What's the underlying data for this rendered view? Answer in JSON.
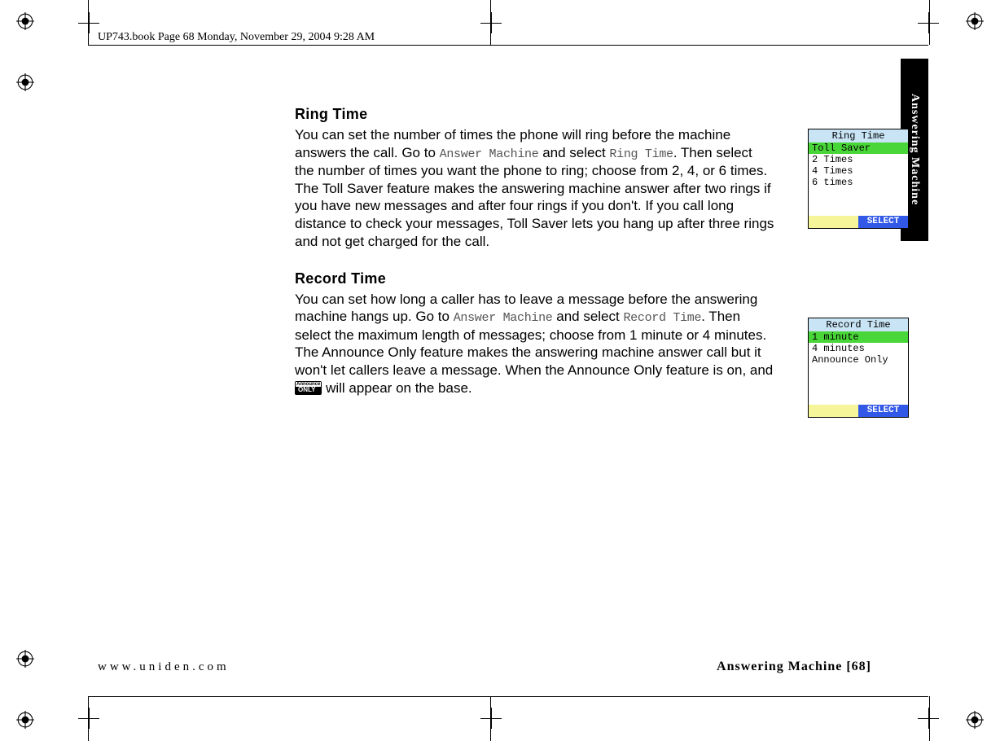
{
  "header_text": "UP743.book  Page 68  Monday, November 29, 2004  9:28 AM",
  "side_tab": "Answering Machine",
  "sections": {
    "ring_time": {
      "title": "Ring Time",
      "body_a": "You can set the number of times the phone will ring before the machine answers the call. Go to ",
      "menu1": "Answer Machine",
      "body_b": " and select ",
      "menu2": "Ring Time",
      "body_c": ". Then select the number of times you want the phone to ring; choose from 2, 4, or 6 times. The Toll Saver feature makes the answering machine answer after two rings if you have new messages and after four rings if you don't. If you call long distance to check your messages, Toll Saver lets you hang up after three rings and not get charged for the call."
    },
    "record_time": {
      "title": "Record Time",
      "body_a": "You can set how long a caller has to leave a message before the answering machine hangs up. Go to ",
      "menu1": "Answer Machine",
      "body_b": " and select ",
      "menu2": "Record Time",
      "body_c": ". Then select the maximum length of messages; choose from 1 minute or 4 minutes. The Announce Only feature makes the answering machine answer call but it won't let callers leave a message. When the Announce Only feature is on, and ",
      "body_d": " will appear on the base.",
      "icon_top": "Announce",
      "icon_bottom": "ONLY"
    }
  },
  "lcd1": {
    "title": "Ring Time",
    "items": [
      "Toll Saver",
      "2 Times",
      "4 Times",
      "6 times"
    ],
    "selected_index": 0,
    "softkey": "SELECT"
  },
  "lcd2": {
    "title": "Record Time",
    "items": [
      "1 minute",
      "4 minutes",
      "Announce Only"
    ],
    "selected_index": 0,
    "softkey": "SELECT"
  },
  "footer": {
    "left": "www.uniden.com",
    "right": "Answering Machine [68]"
  }
}
